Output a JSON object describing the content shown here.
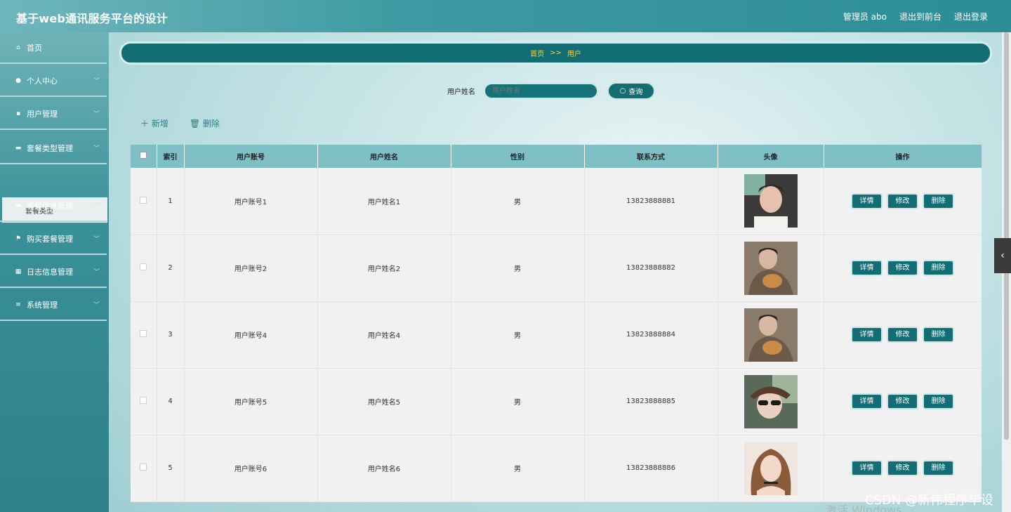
{
  "header": {
    "title": "基于web通讯服务平台的设计",
    "admin_label": "管理员 abo",
    "to_front": "退出到前台",
    "logout": "退出登录"
  },
  "sidebar": {
    "items": [
      {
        "label": "首页",
        "icon": "home-icon"
      },
      {
        "label": "个人中心",
        "icon": "user-icon"
      },
      {
        "label": "用户管理",
        "icon": "clipboard-icon"
      },
      {
        "label": "套餐类型管理",
        "icon": "lock-icon"
      },
      {
        "label": "套餐信息管理",
        "icon": "chat-icon"
      },
      {
        "label": "购买套餐管理",
        "icon": "flag-icon"
      },
      {
        "label": "日志信息管理",
        "icon": "grid-icon"
      },
      {
        "label": "系统管理",
        "icon": "list-icon"
      }
    ],
    "sub_item": "套餐类型"
  },
  "breadcrumb": {
    "home": "首页",
    "sep": ">>",
    "current": "用户"
  },
  "search": {
    "label": "用户姓名",
    "placeholder": "用户姓名",
    "button": "查询"
  },
  "actions": {
    "add": "新增",
    "delete": "删除"
  },
  "table": {
    "headers": [
      "索引",
      "用户账号",
      "用户姓名",
      "性别",
      "联系方式",
      "头像",
      "操作"
    ],
    "rows": [
      {
        "index": "1",
        "account": "用户账号1",
        "name": "用户姓名1",
        "gender": "男",
        "phone": "13823888881"
      },
      {
        "index": "2",
        "account": "用户账号2",
        "name": "用户姓名2",
        "gender": "男",
        "phone": "13823888882"
      },
      {
        "index": "3",
        "account": "用户账号4",
        "name": "用户姓名4",
        "gender": "男",
        "phone": "13823888884"
      },
      {
        "index": "4",
        "account": "用户账号5",
        "name": "用户姓名5",
        "gender": "男",
        "phone": "13823888885"
      },
      {
        "index": "5",
        "account": "用户账号6",
        "name": "用户姓名6",
        "gender": "男",
        "phone": "13823888886"
      }
    ],
    "ops": {
      "detail": "详情",
      "edit": "修改",
      "delete": "删除"
    }
  },
  "watermark": "CSDN @新伟程序毕设",
  "os_watermark": "激活 Windows",
  "colors": {
    "primary": "#126d74",
    "breadcrumb_text": "#f5d547",
    "header_bg": "#7fc0c6"
  }
}
